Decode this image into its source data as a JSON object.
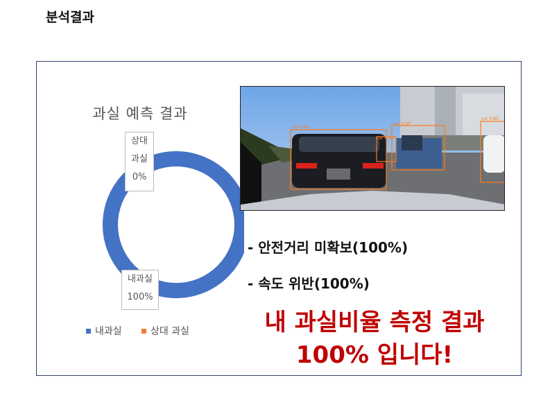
{
  "page": {
    "title": "분석결과"
  },
  "chart": {
    "title": "과실 예측 결과",
    "segments": [
      {
        "label_line1": "내과실",
        "value_text": "100%",
        "color": "#4472c4"
      },
      {
        "label_line1": "상대",
        "label_line2": "과실",
        "value_text": "0%",
        "color": "#ed7d31"
      }
    ],
    "legend": [
      {
        "label": "내과실",
        "color": "#4472c4"
      },
      {
        "label": "상대 과실",
        "color": "#ed7d31"
      }
    ]
  },
  "chart_data": {
    "type": "pie",
    "title": "과실 예측 결과",
    "categories": [
      "내과실",
      "상대 과실"
    ],
    "values": [
      100,
      0
    ],
    "legend_position": "bottom"
  },
  "detections": [
    {
      "label": "car 0.93",
      "color": "#ff7a1a"
    },
    {
      "label": "car 0.44",
      "color": "#ff7a1a"
    },
    {
      "label": "car 0.50",
      "color": "#ff7a1a"
    },
    {
      "label": "car 0.83",
      "color": "#ff7a1a"
    }
  ],
  "findings": [
    "- 안전거리 미확보(100%)",
    "- 속도 위반(100%)"
  ],
  "result": {
    "line1": "내 과실비율 측정 결과",
    "line2": "100% 입니다!",
    "color": "#c00000"
  }
}
